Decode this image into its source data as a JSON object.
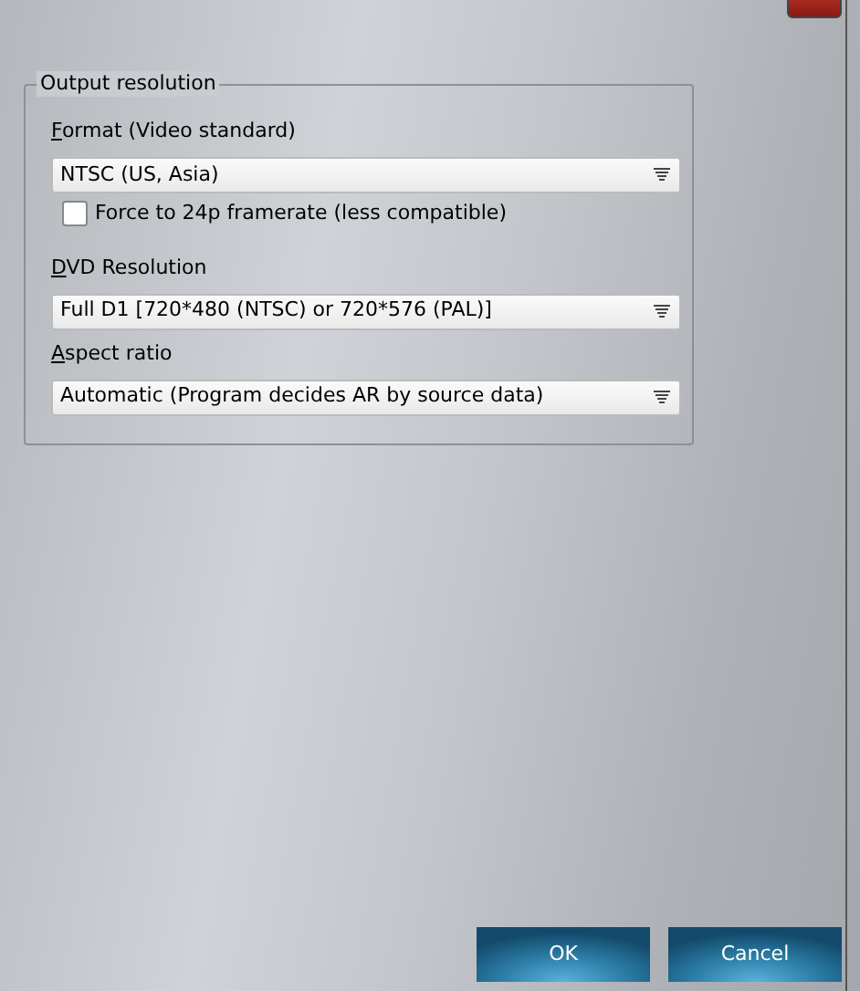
{
  "group": {
    "title": "Output resolution",
    "fields": [
      {
        "kind": "label",
        "text": "Format (Video standard)",
        "first_letter_underlined": true
      },
      {
        "kind": "select",
        "value": "NTSC (US, Asia)"
      },
      {
        "kind": "checkbox",
        "text": "Force to 24p framerate (less compatible)",
        "checked": false
      },
      {
        "kind": "label",
        "text": "DVD Resolution",
        "first_letter_underlined": true
      },
      {
        "kind": "select",
        "value": "Full D1 [720*480 (NTSC) or 720*576 (PAL)]"
      },
      {
        "kind": "label",
        "text": "Aspect ratio",
        "first_letter_underlined": true
      },
      {
        "kind": "select",
        "value": "Automatic (Program decides AR by source data)"
      }
    ]
  },
  "buttons": [
    "OK",
    "Cancel"
  ]
}
